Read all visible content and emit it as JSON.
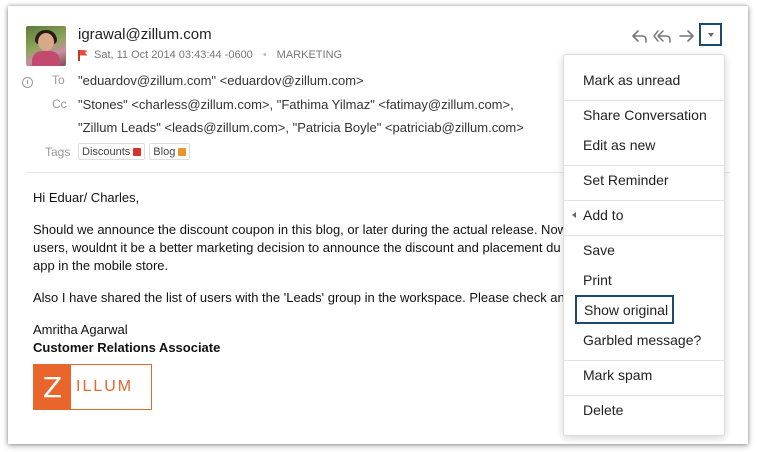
{
  "email": {
    "sender": "igrawal@zillum.com",
    "date": "Sat, 11 Oct 2014 03:43:44 -0600",
    "folder": "MARKETING",
    "to_label": "To",
    "to_value": "\"eduardov@zillum.com\" <eduardov@zillum.com>",
    "cc_label": "Cc",
    "cc_line1": "\"Stones\" <charless@zillum.com>, \"Fathima Yilmaz\" <fatimay@zillum.com>,",
    "cc_line2": "\"Zillum Leads\" <leads@zillum.com>, \"Patricia Boyle\" <patriciab@zillum.com>",
    "tags_label": "Tags",
    "tags": [
      {
        "label": "Discounts",
        "color": "#d0342c"
      },
      {
        "label": "Blog",
        "color": "#e8962e"
      }
    ]
  },
  "body": {
    "greeting": "Hi Eduar/ Charles,",
    "para1_line1": "Should we announce the discount coupon in this blog, or later during the actual release. Now",
    "para1_line2": "users, wouldnt it be a better marketing decision to announce the discount and placement du",
    "para1_line3": "app in the mobile store.",
    "para2": "Also I have shared the list of users with the 'Leads' group in the workspace. Please check and                     s.",
    "signature_name": "Amritha Agarwal",
    "signature_title": "Customer Relations Associate",
    "logo_letter": "Z",
    "logo_rest": "ILLUM"
  },
  "toolbar": {
    "icons": [
      "reply-icon",
      "reply-all-icon",
      "forward-icon",
      "more-dropdown-icon"
    ]
  },
  "menu": {
    "items": [
      "Mark as unread",
      "Share Conversation",
      "Edit as new",
      "Set Reminder",
      "Add to",
      "Save",
      "Print",
      "Show original",
      "Garbled message?",
      "Mark spam",
      "Delete"
    ],
    "highlighted": "Show original"
  },
  "colors": {
    "highlight_border": "#1c4a70",
    "brand_orange": "#e9652c"
  }
}
